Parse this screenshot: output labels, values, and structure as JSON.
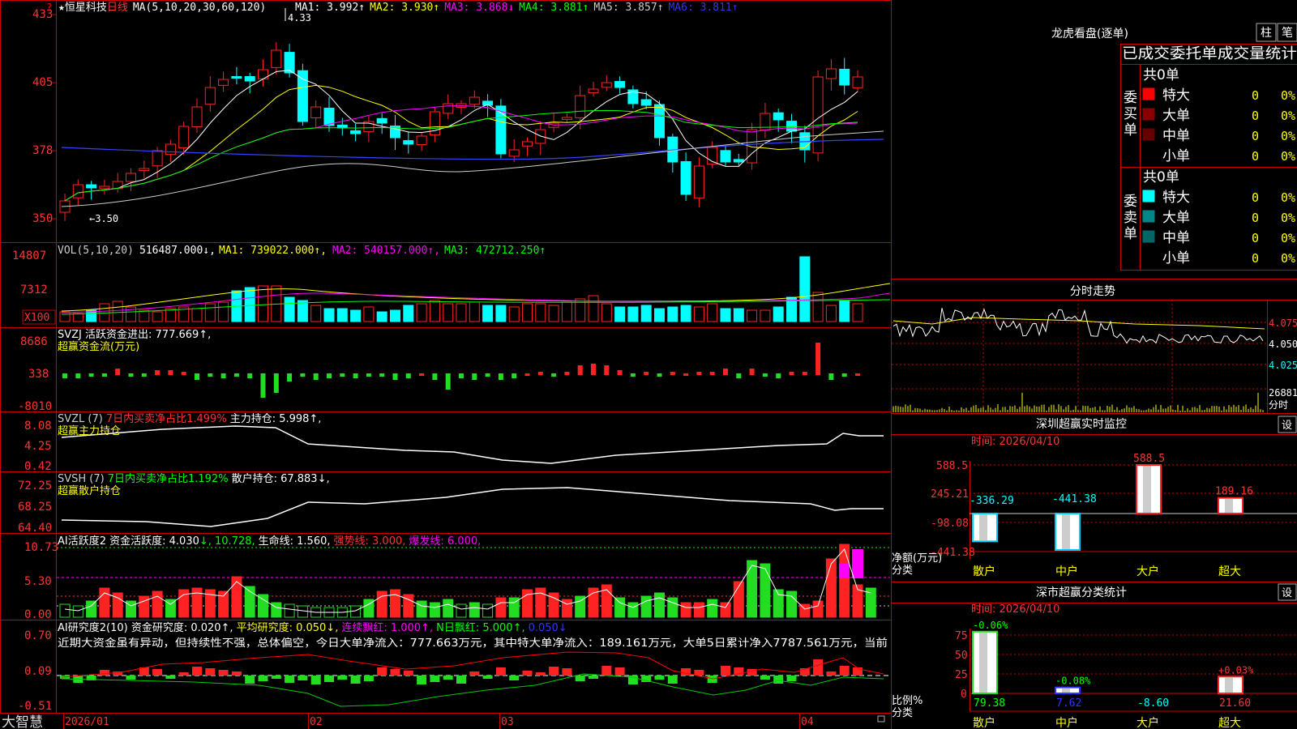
{
  "stock": {
    "star": "★",
    "name": "恒星科技",
    "period": "日线",
    "ma_header": "MA(5,10,20,30,60,120)",
    "ma_values": [
      {
        "label": "MA1:",
        "value": "3.992",
        "arrow": "↑",
        "color": "#ffffff"
      },
      {
        "label": "MA2:",
        "value": "3.930",
        "arrow": "↑",
        "color": "#ffff00"
      },
      {
        "label": "MA3:",
        "value": "3.868",
        "arrow": "↓",
        "color": "#ff00ff"
      },
      {
        "label": "MA4:",
        "value": "3.881",
        "arrow": "↑",
        "color": "#00ff00"
      },
      {
        "label": "MA5:",
        "value": "3.857",
        "arrow": "↑",
        "color": "#cccccc"
      },
      {
        "label": "MA6:",
        "value": "3.811",
        "arrow": "↑",
        "color": "#3333ff"
      }
    ],
    "high_label": "4.33",
    "low_label": "←3.50",
    "y_ticks": [
      "433",
      "405",
      "378",
      "350"
    ],
    "corner_mark": "?"
  },
  "volume": {
    "header_label": "VOL(5,10,20)",
    "header_value": "516487.000↓,",
    "ma1": "MA1: 739022.000↑,",
    "ma2": "MA2: 540157.000↑,",
    "ma3": "MA3: 472712.250↑",
    "y_ticks": [
      "14807",
      "7312"
    ],
    "unit_label": "X100"
  },
  "svzj": {
    "header1": "SVZJ  活跃资金进出: 777.669↑,",
    "header2": "超赢资金流(万元)",
    "y_ticks": [
      "8686",
      "338",
      "-8010"
    ]
  },
  "svzl": {
    "header_prefix": "SVZL (7)",
    "header_red": "7日内买卖净占比1.499%",
    "header_white": "主力持仓: 5.998↑,",
    "header2": "超赢主力持仓",
    "y_ticks": [
      "8.08",
      "4.25",
      "0.42"
    ]
  },
  "svsh": {
    "header_prefix": "SVSH (7)",
    "header_green": "7日内买卖净占比1.192%",
    "header_white": "散户持仓: 67.883↓,",
    "header2": "超赢散户持仓",
    "y_ticks": [
      "72.25",
      "68.25",
      "64.40"
    ]
  },
  "ai_active": {
    "header_white1": "AI活跃度2 资金活跃度: 4.030",
    "header_green": "↓, 10.728,",
    "header_white2": "生命线: 1.560,",
    "header_red": "强势线: 3.000,",
    "header_magenta": "爆发线: 6.000,",
    "y_ticks": [
      "10.73",
      "5.30",
      "0.00"
    ]
  },
  "ai_research": {
    "header_white": "AI研究度2(10) 资金研究度: 0.020↑,",
    "header_yellow": "平均研究度: 0.050↓,",
    "header_magenta": "连续飘红: 1.000↑,",
    "header_green": "N日飘红: 5.000↑,",
    "header_blue": "0.050↓",
    "commentary": "近期大资金虽有异动，但持续性不强，总体偏空，今日大单净流入：777.663万元，其中特大单净流入：189.161万元，大单5日累计净入7787.561万元，当前",
    "y_ticks": [
      "0.70",
      "0.09",
      "-0.51"
    ]
  },
  "bottom_bar": {
    "brand": "大智慧",
    "dates": [
      "2026/01",
      "02",
      "03",
      "04"
    ]
  },
  "right_panel": {
    "title": "龙虎看盘(逐单)",
    "btn_zhu": "柱",
    "btn_bi": "笔",
    "subtitle": "已成交委托单成交量统计",
    "buy_side": {
      "side_label": [
        "委",
        "买",
        "单"
      ],
      "total": "共0单",
      "rows": [
        {
          "label": "特大",
          "count": "0",
          "pct": "0%",
          "color": "#ff0000"
        },
        {
          "label": "大单",
          "count": "0",
          "pct": "0%",
          "color": "#880000"
        },
        {
          "label": "中单",
          "count": "0",
          "pct": "0%",
          "color": "#660000"
        },
        {
          "label": "小单",
          "count": "0",
          "pct": "0%",
          "color": "#000000"
        }
      ]
    },
    "sell_side": {
      "side_label": [
        "委",
        "卖",
        "单"
      ],
      "total": "共0单",
      "rows": [
        {
          "label": "特大",
          "count": "0",
          "pct": "0%",
          "color": "#00ffff"
        },
        {
          "label": "大单",
          "count": "0",
          "pct": "0%",
          "color": "#008888"
        },
        {
          "label": "中单",
          "count": "0",
          "pct": "0%",
          "color": "#006666"
        },
        {
          "label": "小单",
          "count": "0",
          "pct": "0%",
          "color": "#000000"
        }
      ]
    },
    "intraday": {
      "title": "分时走势",
      "prices": [
        "4.075",
        "4.050",
        "4.025"
      ],
      "vol": [
        "26881",
        "分时"
      ]
    },
    "sz_monitor": {
      "title": "深圳超赢实时监控",
      "set": "设",
      "time": "时间: 2026/04/10",
      "y_ticks": [
        "588.5",
        "245.21",
        "-98.08",
        "-441.38"
      ],
      "y_label1": "净额(万元)",
      "y_label2": "分类",
      "bars": [
        {
          "cat": "散户",
          "value": "-336.29"
        },
        {
          "cat": "中户",
          "value": "-441.38"
        },
        {
          "cat": "大户",
          "value": "588.5"
        },
        {
          "cat": "超大",
          "value": "189.16"
        }
      ]
    },
    "sz_classify": {
      "title": "深市超赢分类统计",
      "set": "设",
      "time": "时间: 2026/04/10",
      "y_ticks": [
        "75",
        "50",
        "25",
        "0"
      ],
      "y_label1": "比例%",
      "y_label2": "分类",
      "bars": [
        {
          "cat": "散户",
          "ratio": "79.38",
          "delta": "-0.06%"
        },
        {
          "cat": "中户",
          "ratio": "7.62",
          "delta": "-0.08%"
        },
        {
          "cat": "大户",
          "ratio": "-8.60",
          "delta": ""
        },
        {
          "cat": "超大",
          "ratio": "21.60",
          "delta": "+0.03%"
        }
      ]
    }
  }
}
